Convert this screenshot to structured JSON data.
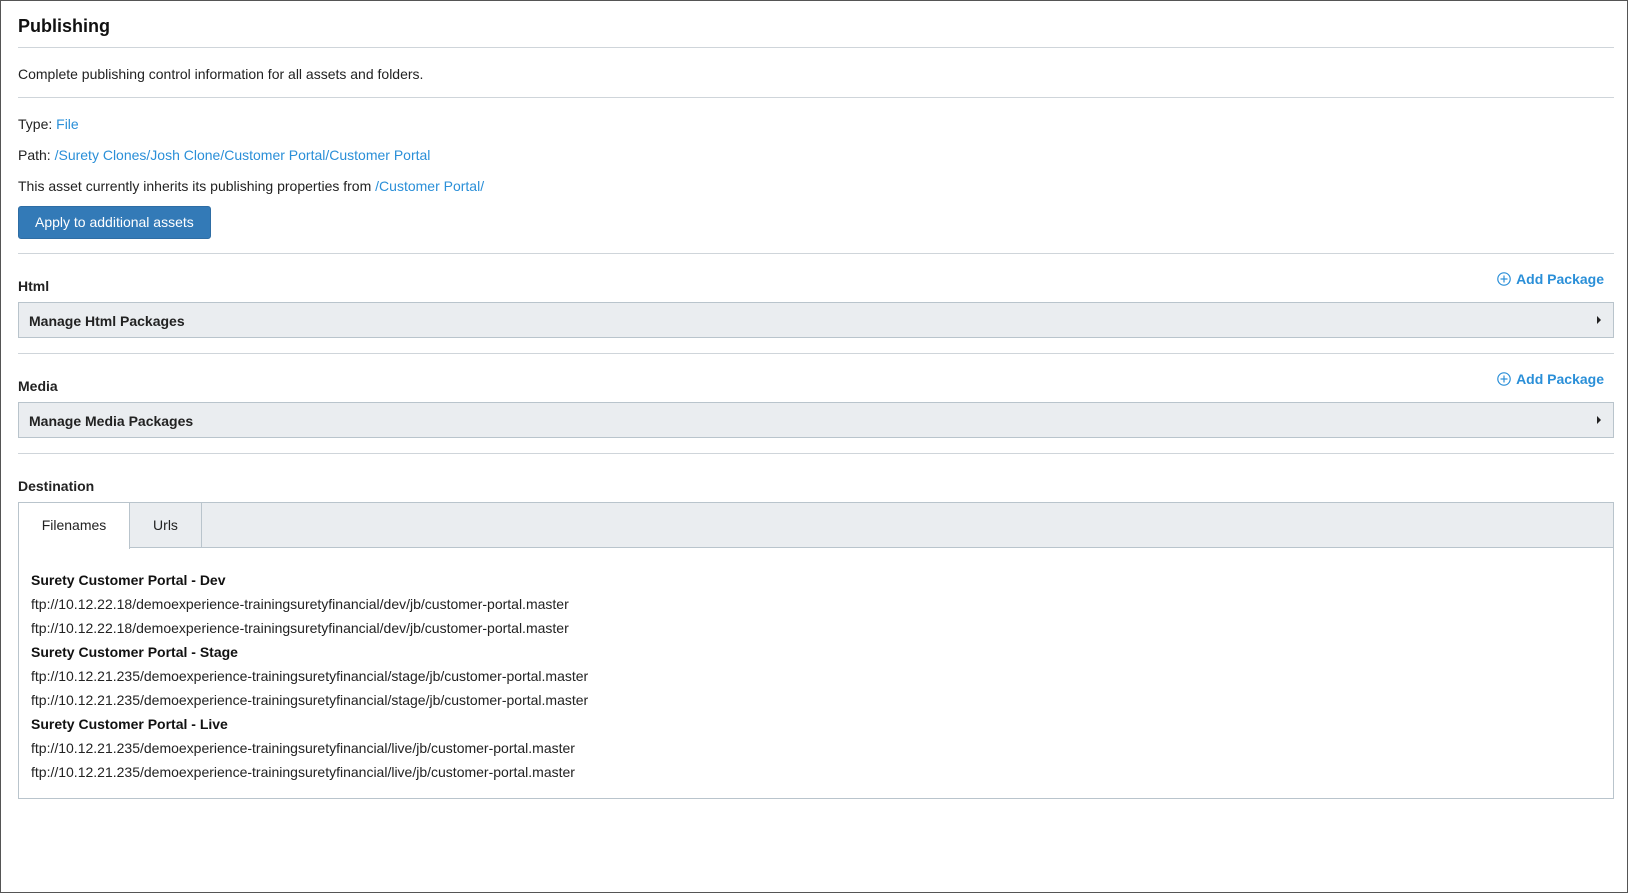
{
  "header": {
    "title": "Publishing"
  },
  "description": "Complete publishing control information for all assets and folders.",
  "info": {
    "type_label": "Type:",
    "type_value": "File",
    "path_label": "Path:",
    "path_value": "/Surety Clones/Josh Clone/Customer Portal/Customer Portal",
    "inherit_text": "This asset currently inherits its publishing properties from",
    "inherit_link": "/Customer Portal/"
  },
  "apply_button": "Apply to additional assets",
  "html_section": {
    "label": "Html",
    "add_package": "Add Package",
    "accordion": "Manage Html Packages"
  },
  "media_section": {
    "label": "Media",
    "add_package": "Add Package",
    "accordion": "Manage Media Packages"
  },
  "destination": {
    "label": "Destination",
    "tabs": [
      {
        "label": "Filenames",
        "active": true
      },
      {
        "label": "Urls",
        "active": false
      }
    ],
    "groups": [
      {
        "title": "Surety Customer Portal - Dev",
        "urls": [
          "ftp://10.12.22.18/demoexperience-trainingsuretyfinancial/dev/jb/customer-portal.master",
          "ftp://10.12.22.18/demoexperience-trainingsuretyfinancial/dev/jb/customer-portal.master"
        ]
      },
      {
        "title": "Surety Customer Portal - Stage",
        "urls": [
          "ftp://10.12.21.235/demoexperience-trainingsuretyfinancial/stage/jb/customer-portal.master",
          "ftp://10.12.21.235/demoexperience-trainingsuretyfinancial/stage/jb/customer-portal.master"
        ]
      },
      {
        "title": "Surety Customer Portal - Live",
        "urls": [
          "ftp://10.12.21.235/demoexperience-trainingsuretyfinancial/live/jb/customer-portal.master",
          "ftp://10.12.21.235/demoexperience-trainingsuretyfinancial/live/jb/customer-portal.master"
        ]
      }
    ]
  },
  "colors": {
    "link": "#2a8fd8",
    "primary_button": "#337ab7",
    "panel_bg": "#eaedf0",
    "border": "#b9c4cc"
  },
  "icons": {
    "add_package": "plus-circle-icon",
    "accordion_toggle": "caret-right-icon"
  }
}
